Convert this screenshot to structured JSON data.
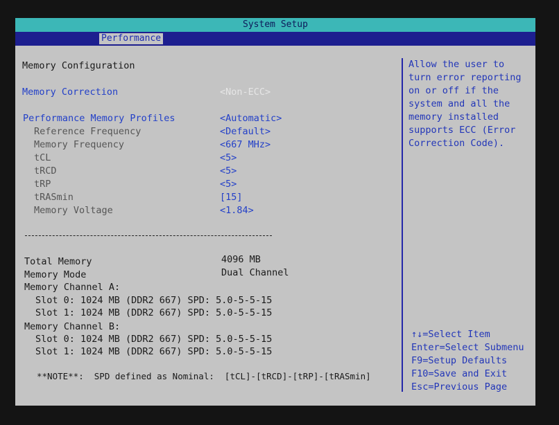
{
  "title": "System Setup",
  "tab": "Performance",
  "section_title": "Memory Configuration",
  "memory_correction": {
    "label": "Memory Correction",
    "value": "<Non-ECC>"
  },
  "profiles": {
    "label": "Performance Memory Profiles",
    "value": "<Automatic>"
  },
  "settings": [
    {
      "label": "Reference Frequency",
      "value": "<Default>"
    },
    {
      "label": "Memory Frequency",
      "value": "<667 MHz>"
    },
    {
      "label": "tCL",
      "value": "<5>"
    },
    {
      "label": "tRCD",
      "value": "<5>"
    },
    {
      "label": "tRP",
      "value": "<5>"
    },
    {
      "label": "tRASmin",
      "value": "[15]"
    },
    {
      "label": "Memory Voltage",
      "value": "<1.84>"
    }
  ],
  "info": {
    "total_memory_label": "Total Memory",
    "total_memory_value": "4096 MB",
    "memory_mode_label": "Memory Mode",
    "memory_mode_value": "Dual Channel",
    "channel_a": "Memory Channel A:",
    "channel_a_slot0": "Slot 0: 1024 MB (DDR2 667) SPD: 5.0-5-5-15",
    "channel_a_slot1": "Slot 1: 1024 MB (DDR2 667) SPD: 5.0-5-5-15",
    "channel_b": "Memory Channel B:",
    "channel_b_slot0": "Slot 0: 1024 MB (DDR2 667) SPD: 5.0-5-5-15",
    "channel_b_slot1": "Slot 1: 1024 MB (DDR2 667) SPD: 5.0-5-5-15",
    "note": "**NOTE**:  SPD defined as Nominal:  [tCL]-[tRCD]-[tRP]-[tRASmin]"
  },
  "help_text": "Allow the user to turn error reporting on or off if the system and all the memory installed supports ECC (Error Correction Code).",
  "keys": [
    "↑↓=Select Item",
    "Enter=Select Submenu",
    "F9=Setup Defaults",
    "F10=Save and Exit",
    "Esc=Previous Page"
  ]
}
